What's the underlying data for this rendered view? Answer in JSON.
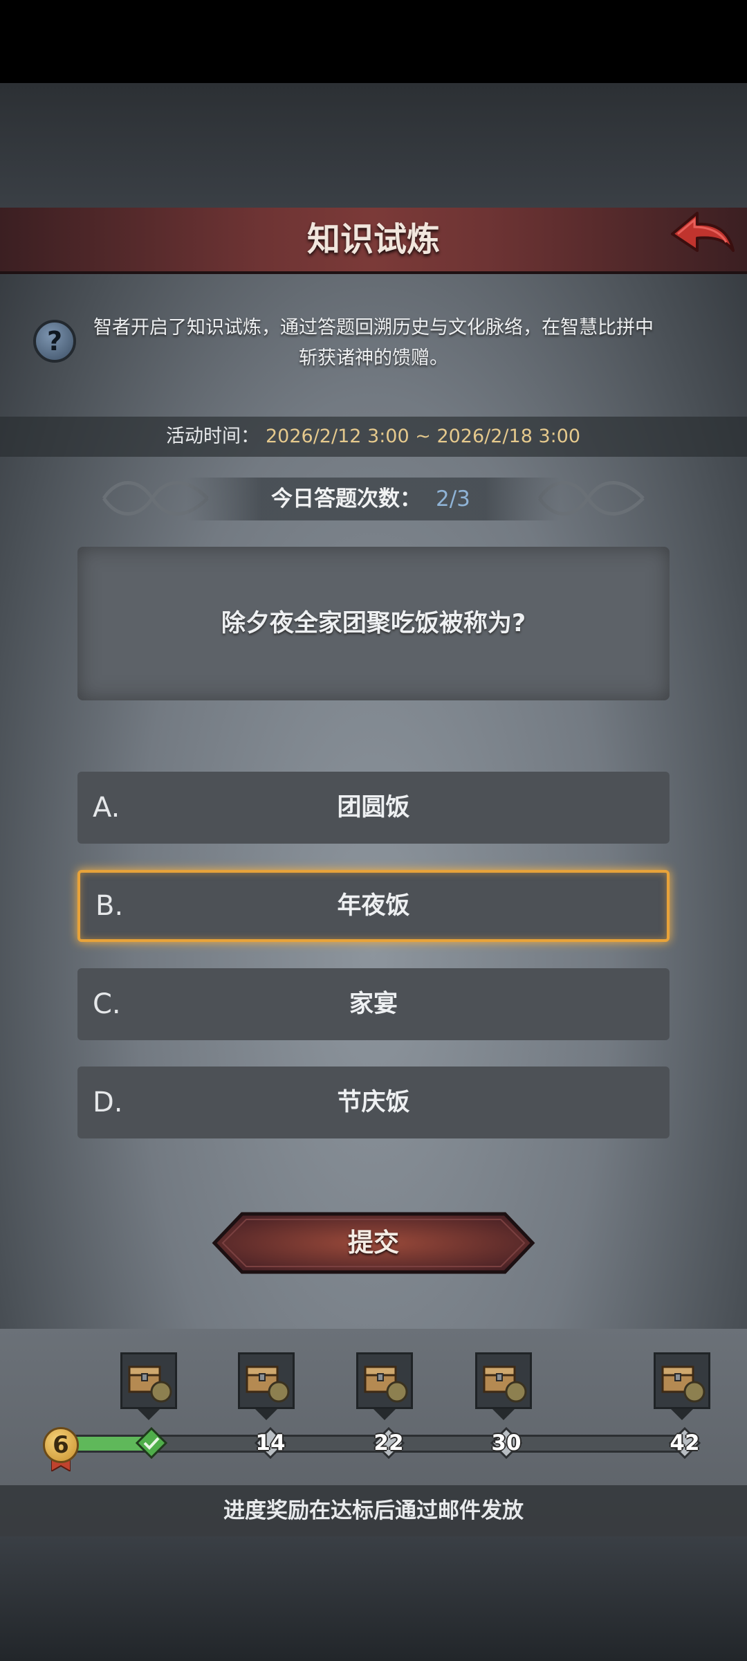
{
  "header": {
    "title": "知识试炼"
  },
  "intro": {
    "line1": "智者开启了知识试炼，通过答题回溯历史与文化脉络，在智慧比拼中",
    "line2": "斩获诸神的馈赠。"
  },
  "event_time": {
    "label": "活动时间：",
    "value": "2026/2/12 3:00 ~ 2026/2/18 3:00"
  },
  "daily_count": {
    "label": "今日答题次数：",
    "value": "2/3"
  },
  "question": {
    "text": "除夕夜全家团聚吃饭被称为?"
  },
  "options": [
    {
      "letter": "A.",
      "text": "团圆饭",
      "selected": false
    },
    {
      "letter": "B.",
      "text": "年夜饭",
      "selected": true
    },
    {
      "letter": "C.",
      "text": "家宴",
      "selected": false
    },
    {
      "letter": "D.",
      "text": "节庆饭",
      "selected": false
    }
  ],
  "submit": {
    "label": "提交"
  },
  "progress": {
    "current": "6",
    "milestones": [
      {
        "value": "",
        "reached": true
      },
      {
        "value": "14",
        "reached": false
      },
      {
        "value": "22",
        "reached": false
      },
      {
        "value": "30",
        "reached": false
      },
      {
        "value": "42",
        "reached": false
      }
    ],
    "note": "进度奖励在达标后通过邮件发放"
  },
  "colors": {
    "accent_gold": "#e5c98d",
    "selected_border": "#e8a33a",
    "progress_fill": "#5fb85a",
    "header_red": "#7b3a38"
  }
}
